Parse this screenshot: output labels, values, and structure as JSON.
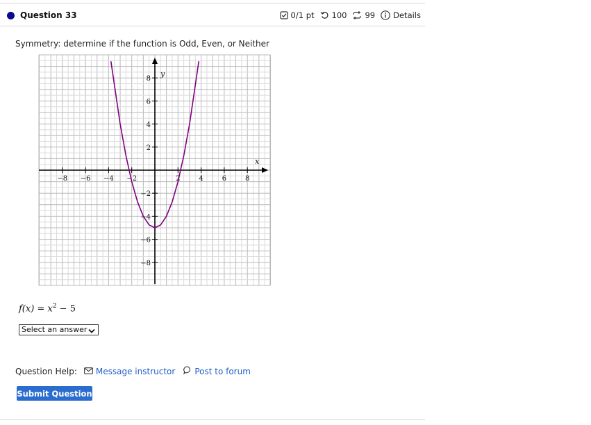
{
  "question": {
    "title": "Question 33",
    "score": "0/1 pt",
    "retries": "100",
    "attempts": "99",
    "details_label": "Details",
    "icons": {
      "status": "filled-circle-icon",
      "score": "checkbox-icon",
      "retries": "undo-icon",
      "attempts": "repeat-icon",
      "details": "info-icon"
    },
    "accent_color": "#0a0a8c"
  },
  "prompt": "Symmetry:  determine if the function is Odd, Even, or Neither",
  "function": {
    "lhs": "f(x)",
    "eq": " = ",
    "base": "x",
    "exponent": "2",
    "tail": " − 5"
  },
  "answer_select": {
    "selected": "Select an answer",
    "icon": "chevron-down-icon"
  },
  "help": {
    "label": "Question Help:",
    "message_link": "Message instructor",
    "forum_link": "Post to forum",
    "message_icon": "envelope-icon",
    "forum_icon": "speech-bubble-icon",
    "link_color": "#2460c9"
  },
  "submit_label": "Submit Question",
  "submit_color": "#2b6ccf",
  "chart_data": {
    "type": "line",
    "xlabel": "x",
    "ylabel": "y",
    "xlim": [
      -10,
      10
    ],
    "ylim": [
      -10,
      10
    ],
    "grid": true,
    "x_ticks": [
      -8,
      -6,
      -4,
      -2,
      2,
      4,
      6,
      8
    ],
    "y_ticks": [
      -8,
      -6,
      -4,
      -2,
      2,
      4,
      6,
      8
    ],
    "series": [
      {
        "color": "#800080",
        "x": [
          -3.8,
          -3,
          -2.5,
          -2,
          -1.5,
          -1,
          -0.5,
          0,
          0.5,
          1,
          1.5,
          2,
          2.5,
          3,
          3.8
        ],
        "y": [
          9.44,
          4,
          1.25,
          -1,
          -2.75,
          -4,
          -4.75,
          -5,
          -4.75,
          -4,
          -2.75,
          -1,
          1.25,
          4,
          9.44
        ]
      }
    ]
  }
}
